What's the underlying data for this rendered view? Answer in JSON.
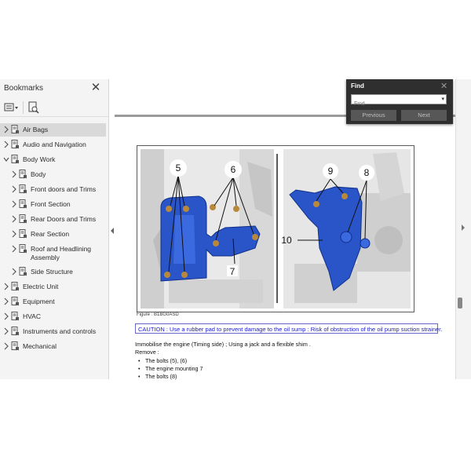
{
  "sidebar": {
    "title": "Bookmarks",
    "items": [
      {
        "label": "Air Bags",
        "level": 0,
        "expanded": false,
        "selected": true
      },
      {
        "label": "Audio and Navigation",
        "level": 0,
        "expanded": false
      },
      {
        "label": "Body Work",
        "level": 0,
        "expanded": true
      },
      {
        "label": "Body",
        "level": 1,
        "expanded": false
      },
      {
        "label": "Front doors and Trims",
        "level": 1,
        "expanded": false
      },
      {
        "label": "Front Section",
        "level": 1,
        "expanded": false
      },
      {
        "label": "Rear Doors and Trims",
        "level": 1,
        "expanded": false
      },
      {
        "label": "Rear Section",
        "level": 1,
        "expanded": false
      },
      {
        "label": "Roof and Headlining Assembly",
        "level": 1,
        "expanded": false
      },
      {
        "label": "Side Structure",
        "level": 1,
        "expanded": false
      },
      {
        "label": "Electric Unit",
        "level": 0,
        "expanded": false
      },
      {
        "label": "Equipment",
        "level": 0,
        "expanded": false
      },
      {
        "label": "HVAC",
        "level": 0,
        "expanded": false
      },
      {
        "label": "Instruments and controls",
        "level": 0,
        "expanded": false
      },
      {
        "label": "Mechanical",
        "level": 0,
        "expanded": false
      }
    ]
  },
  "figure": {
    "callouts_left": [
      "5",
      "6",
      "7"
    ],
    "callouts_right": [
      "9",
      "8",
      "10"
    ],
    "caption": "Figure : B1BG0ASD"
  },
  "document": {
    "caution": "CAUTION : Use a rubber pad to prevent damage to the oil sump : Risk of obstruction of the oil pump suction strainer.",
    "intro": "Immobilise the engine (Timing side) ; Using a jack and a flexible shim .",
    "remove_label": "Remove :",
    "bullets": [
      "The bolts (5), (6)",
      "The engine mounting 7",
      "The bolts (8)"
    ]
  },
  "find": {
    "title": "Find",
    "placeholder": "Find",
    "previous": "Previous",
    "next": "Next"
  },
  "colors": {
    "part_blue": "#2a55c8",
    "caution_text": "#1a1acc",
    "selected_row": "#d9d9d9"
  }
}
